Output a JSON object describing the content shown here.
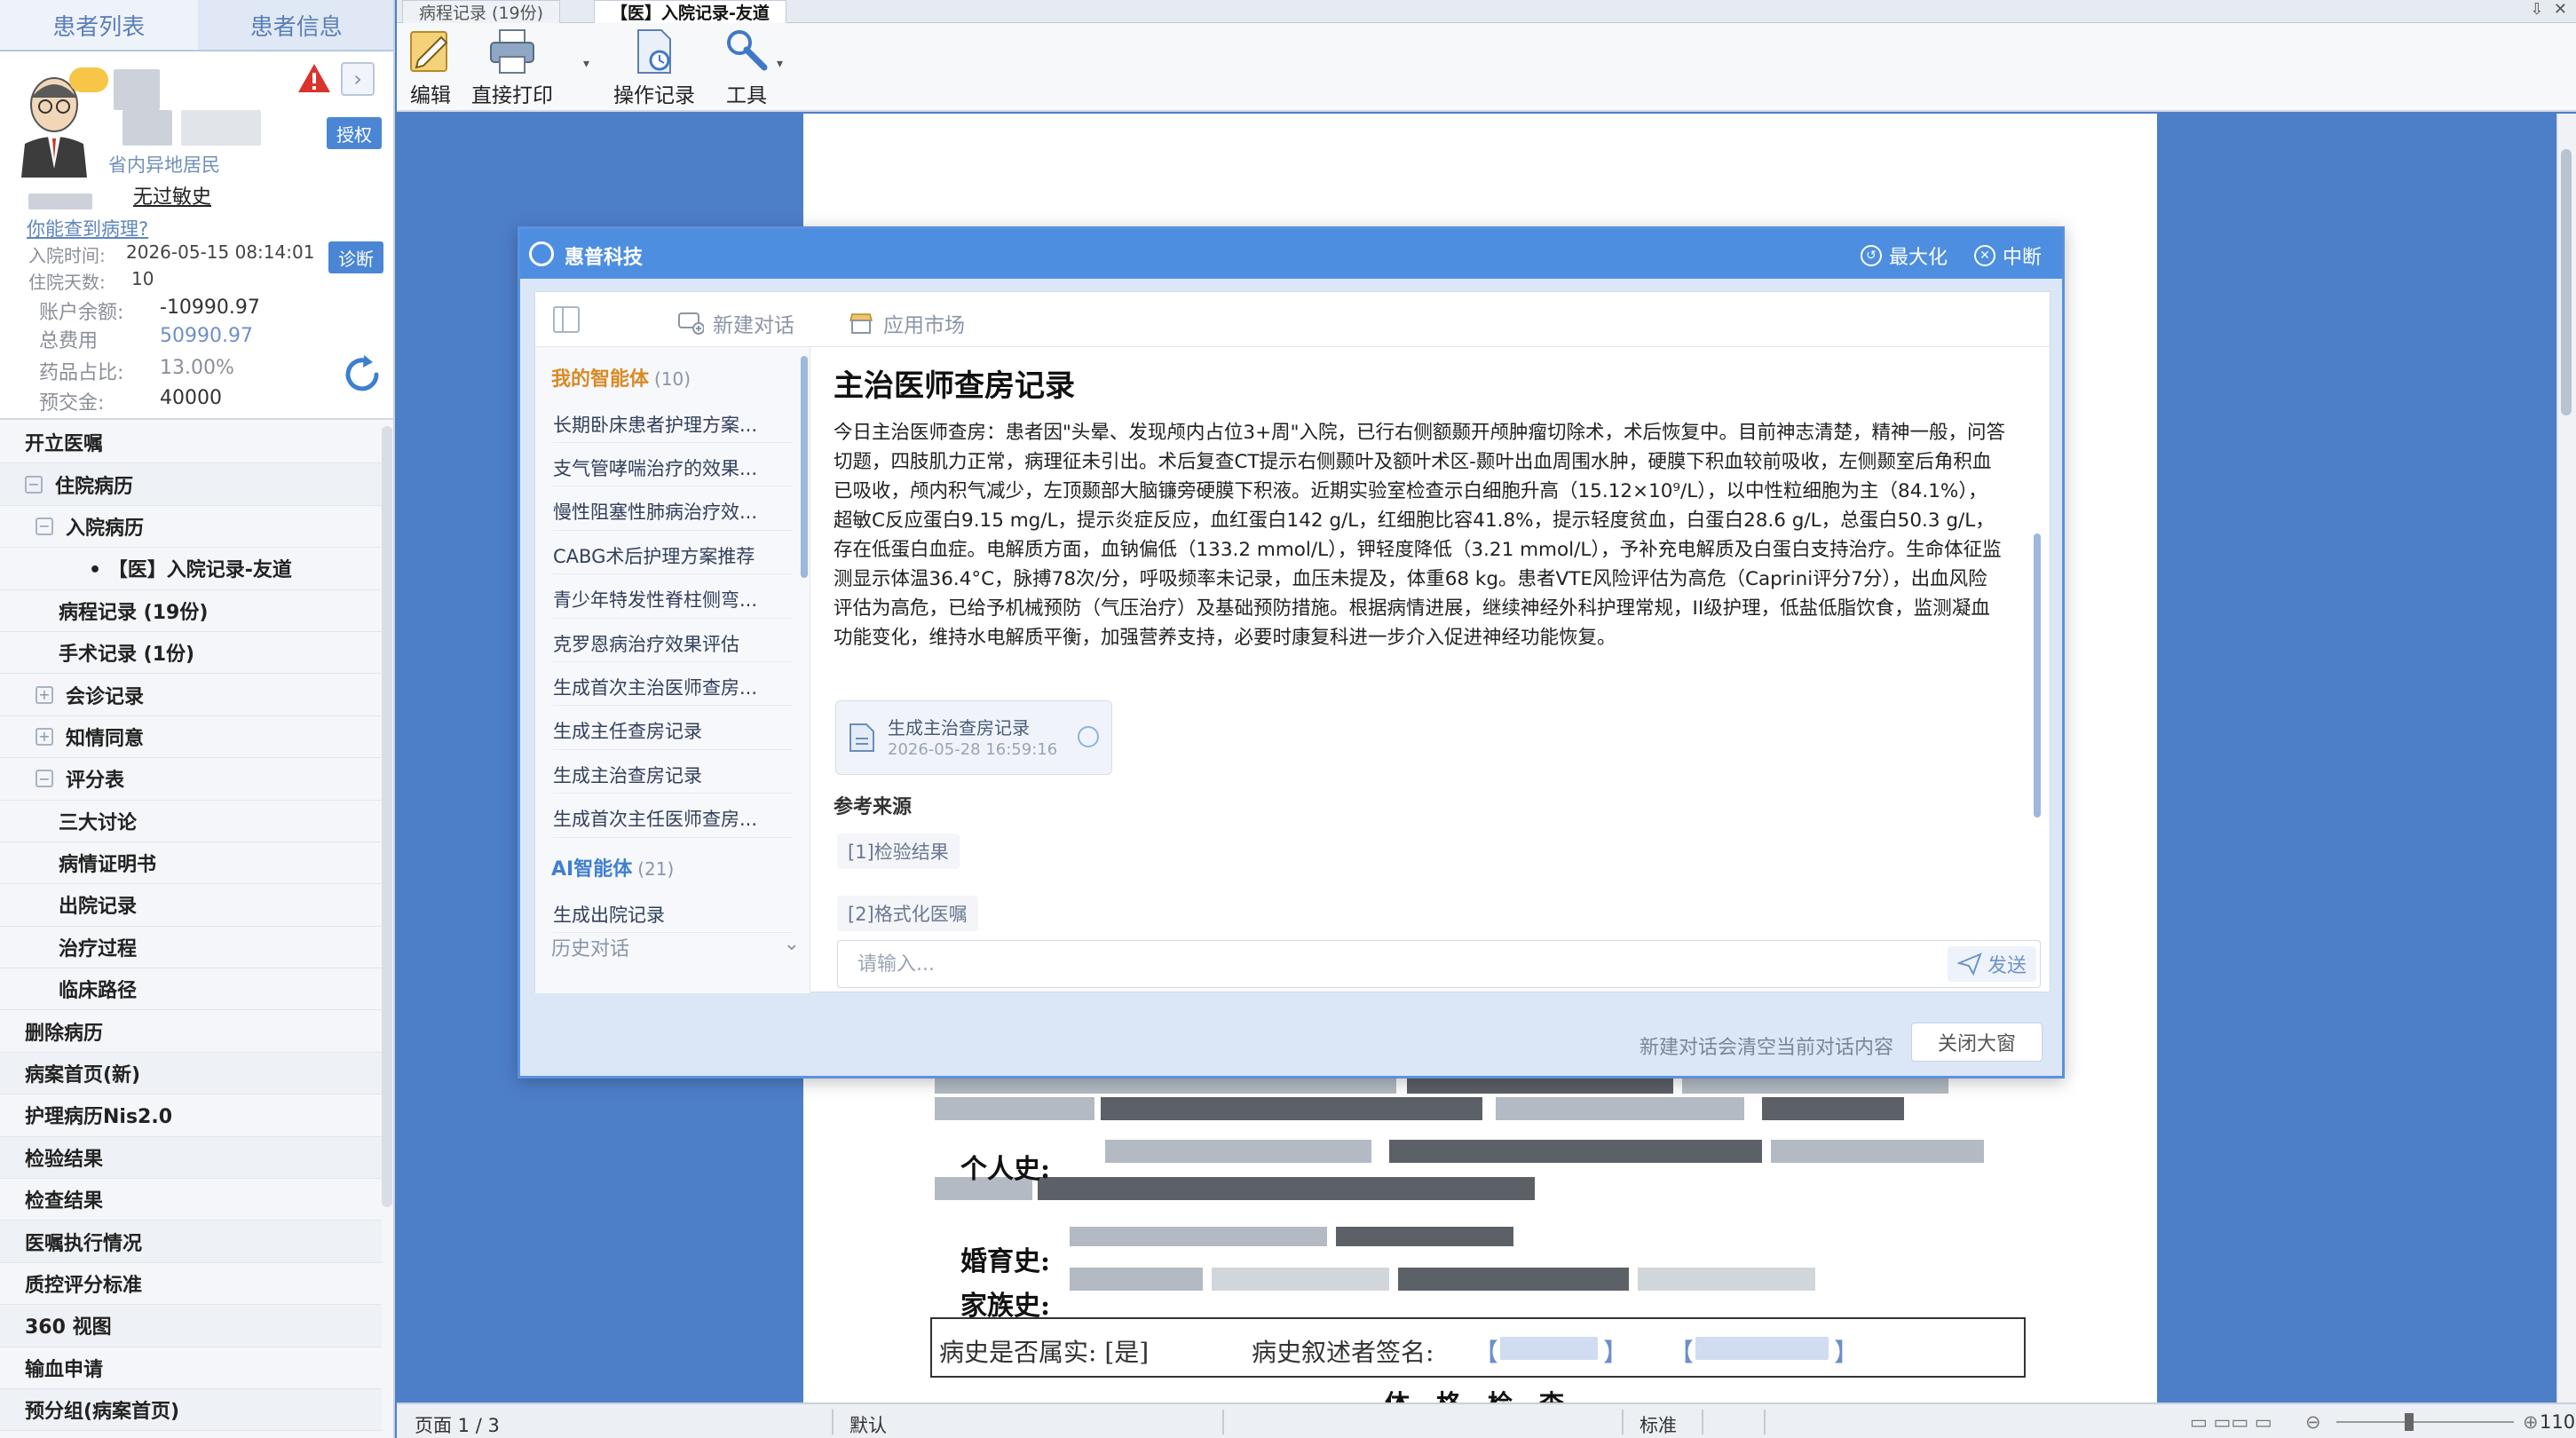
{
  "sidebar": {
    "tabs": [
      "患者列表",
      "患者信息"
    ],
    "patient": {
      "area": "省内异地居民",
      "allergy": "无过敏史",
      "allergy_question": "你能查到病理?",
      "admit_label": "入院时间:",
      "admit_value": "2026-05-15 08:14:01",
      "stay_label": "住院天数:",
      "stay_value": "10",
      "auth_label": "授权",
      "diag_label": "诊断",
      "balance_label": "账户余额:",
      "balance_value": "-10990.97",
      "total_label": "总费用",
      "total_value": "50990.97",
      "drug_label": "药品占比:",
      "drug_value": "13.00%",
      "prepay_label": "预交金:",
      "prepay_value": "40000"
    },
    "nav": [
      {
        "label": "开立医嘱",
        "indent": 0,
        "toggle": ""
      },
      {
        "label": "住院病历",
        "indent": 0,
        "toggle": "−"
      },
      {
        "label": "入院病历",
        "indent": 1,
        "toggle": "−"
      },
      {
        "label": "• 【医】入院记录-友道",
        "indent": 3,
        "toggle": ""
      },
      {
        "label": "病程记录 (19份)",
        "indent": 2,
        "toggle": ""
      },
      {
        "label": "手术记录 (1份)",
        "indent": 2,
        "toggle": ""
      },
      {
        "label": "会诊记录",
        "indent": 1,
        "toggle": "+"
      },
      {
        "label": "知情同意",
        "indent": 1,
        "toggle": "+"
      },
      {
        "label": "评分表",
        "indent": 1,
        "toggle": "−"
      },
      {
        "label": "三大讨论",
        "indent": 2,
        "toggle": ""
      },
      {
        "label": "病情证明书",
        "indent": 2,
        "toggle": ""
      },
      {
        "label": "出院记录",
        "indent": 2,
        "toggle": ""
      },
      {
        "label": "治疗过程",
        "indent": 2,
        "toggle": ""
      },
      {
        "label": "临床路径",
        "indent": 2,
        "toggle": ""
      },
      {
        "label": "删除病历",
        "indent": 0,
        "toggle": ""
      },
      {
        "label": "病案首页(新)",
        "indent": 0,
        "toggle": ""
      },
      {
        "label": "护理病历Nis2.0",
        "indent": 0,
        "toggle": ""
      },
      {
        "label": "检验结果",
        "indent": 0,
        "toggle": ""
      },
      {
        "label": "检查结果",
        "indent": 0,
        "toggle": ""
      },
      {
        "label": "医嘱执行情况",
        "indent": 0,
        "toggle": ""
      },
      {
        "label": "质控评分标准",
        "indent": 0,
        "toggle": ""
      },
      {
        "label": "360 视图",
        "indent": 0,
        "toggle": ""
      },
      {
        "label": "输血申请",
        "indent": 0,
        "toggle": ""
      },
      {
        "label": "预分组(病案首页)",
        "indent": 0,
        "toggle": ""
      }
    ]
  },
  "doc_tabs": [
    "病程记录 (19份)",
    "【医】入院记录-友道"
  ],
  "toolbar": {
    "edit": "编辑",
    "print": "直接打印",
    "oplog": "操作记录",
    "tools": "工具"
  },
  "document": {
    "personal_history": "个人史:",
    "marriage_history": "婚育史:",
    "family_history": "家族史:",
    "history_reliable": "病史是否属实: [是]",
    "narrator_sign": "病史叙述者签名:",
    "next_heading": "体格检查"
  },
  "statusbar": {
    "page": "页面 1 / 3",
    "mode": "默认",
    "standard": "标准",
    "zoom": "110%"
  },
  "dialog": {
    "title": "惠普科技",
    "maximize": "最大化",
    "close_x": "中断",
    "new_chat": "新建对话",
    "app_market": "应用市场",
    "my_agents_title": "我的智能体",
    "my_agents_count": "(10)",
    "my_agents": [
      "长期卧床患者护理方案...",
      "支气管哮喘治疗的效果...",
      "慢性阻塞性肺病治疗效...",
      "CABG术后护理方案推荐",
      "青少年特发性脊柱侧弯...",
      "克罗恩病治疗效果评估",
      "生成首次主治医师查房...",
      "生成主任查房记录",
      "生成主治查房记录",
      "生成首次主任医师查房..."
    ],
    "ai_agents_title": "AI智能体",
    "ai_agents_count": "(21)",
    "ai_agents": [
      "生成出院记录"
    ],
    "history_label": "历史对话",
    "chat_title": "主治医师查房记录",
    "chat_body": "今日主治医师查房：患者因\"头晕、发现颅内占位3+周\"入院，已行右侧额颞开颅肿瘤切除术，术后恢复中。目前神志清楚，精神一般，问答切题，四肢肌力正常，病理征未引出。术后复查CT提示右侧颞叶及额叶术区-颞叶出血周围水肿，硬膜下积血较前吸收，左侧颞室后角积血已吸收，颅内积气减少，左顶颞部大脑镰旁硬膜下积液。近期实验室检查示白细胞升高（15.12×10⁹/L），以中性粒细胞为主（84.1%），超敏C反应蛋白9.15 mg/L，提示炎症反应，血红蛋白142 g/L，红细胞比容41.8%，提示轻度贫血，白蛋白28.6 g/L，总蛋白50.3 g/L，存在低蛋白血症。电解质方面，血钠偏低（133.2 mmol/L），钾轻度降低（3.21 mmol/L），予补充电解质及白蛋白支持治疗。生命体征监测显示体温36.4°C，脉搏78次/分，呼吸频率未记录，血压未提及，体重68 kg。患者VTE风险评估为高危（Caprini评分7分），出血风险评估为高危，已给予机械预防（气压治疗）及基础预防措施。根据病情进展，继续神经外科护理常规，II级护理，低盐低脂饮食，监测凝血功能变化，维持水电解质平衡，加强营养支持，必要时康复科进一步介入促进神经功能恢复。",
    "file_name": "生成主治查房记录",
    "file_time": "2026-05-28 16:59:16",
    "ref_title": "参考来源",
    "refs": [
      "[1]检验结果",
      "[2]格式化医嘱"
    ],
    "input_placeholder": "请输入...",
    "send": "发送",
    "footer_note": "新建对话会清空当前对话内容",
    "close_window": "关闭大窗"
  },
  "colors": {
    "accent": "#4d8ee0",
    "background": "#4d7fc9",
    "link": "#5e85bd"
  }
}
